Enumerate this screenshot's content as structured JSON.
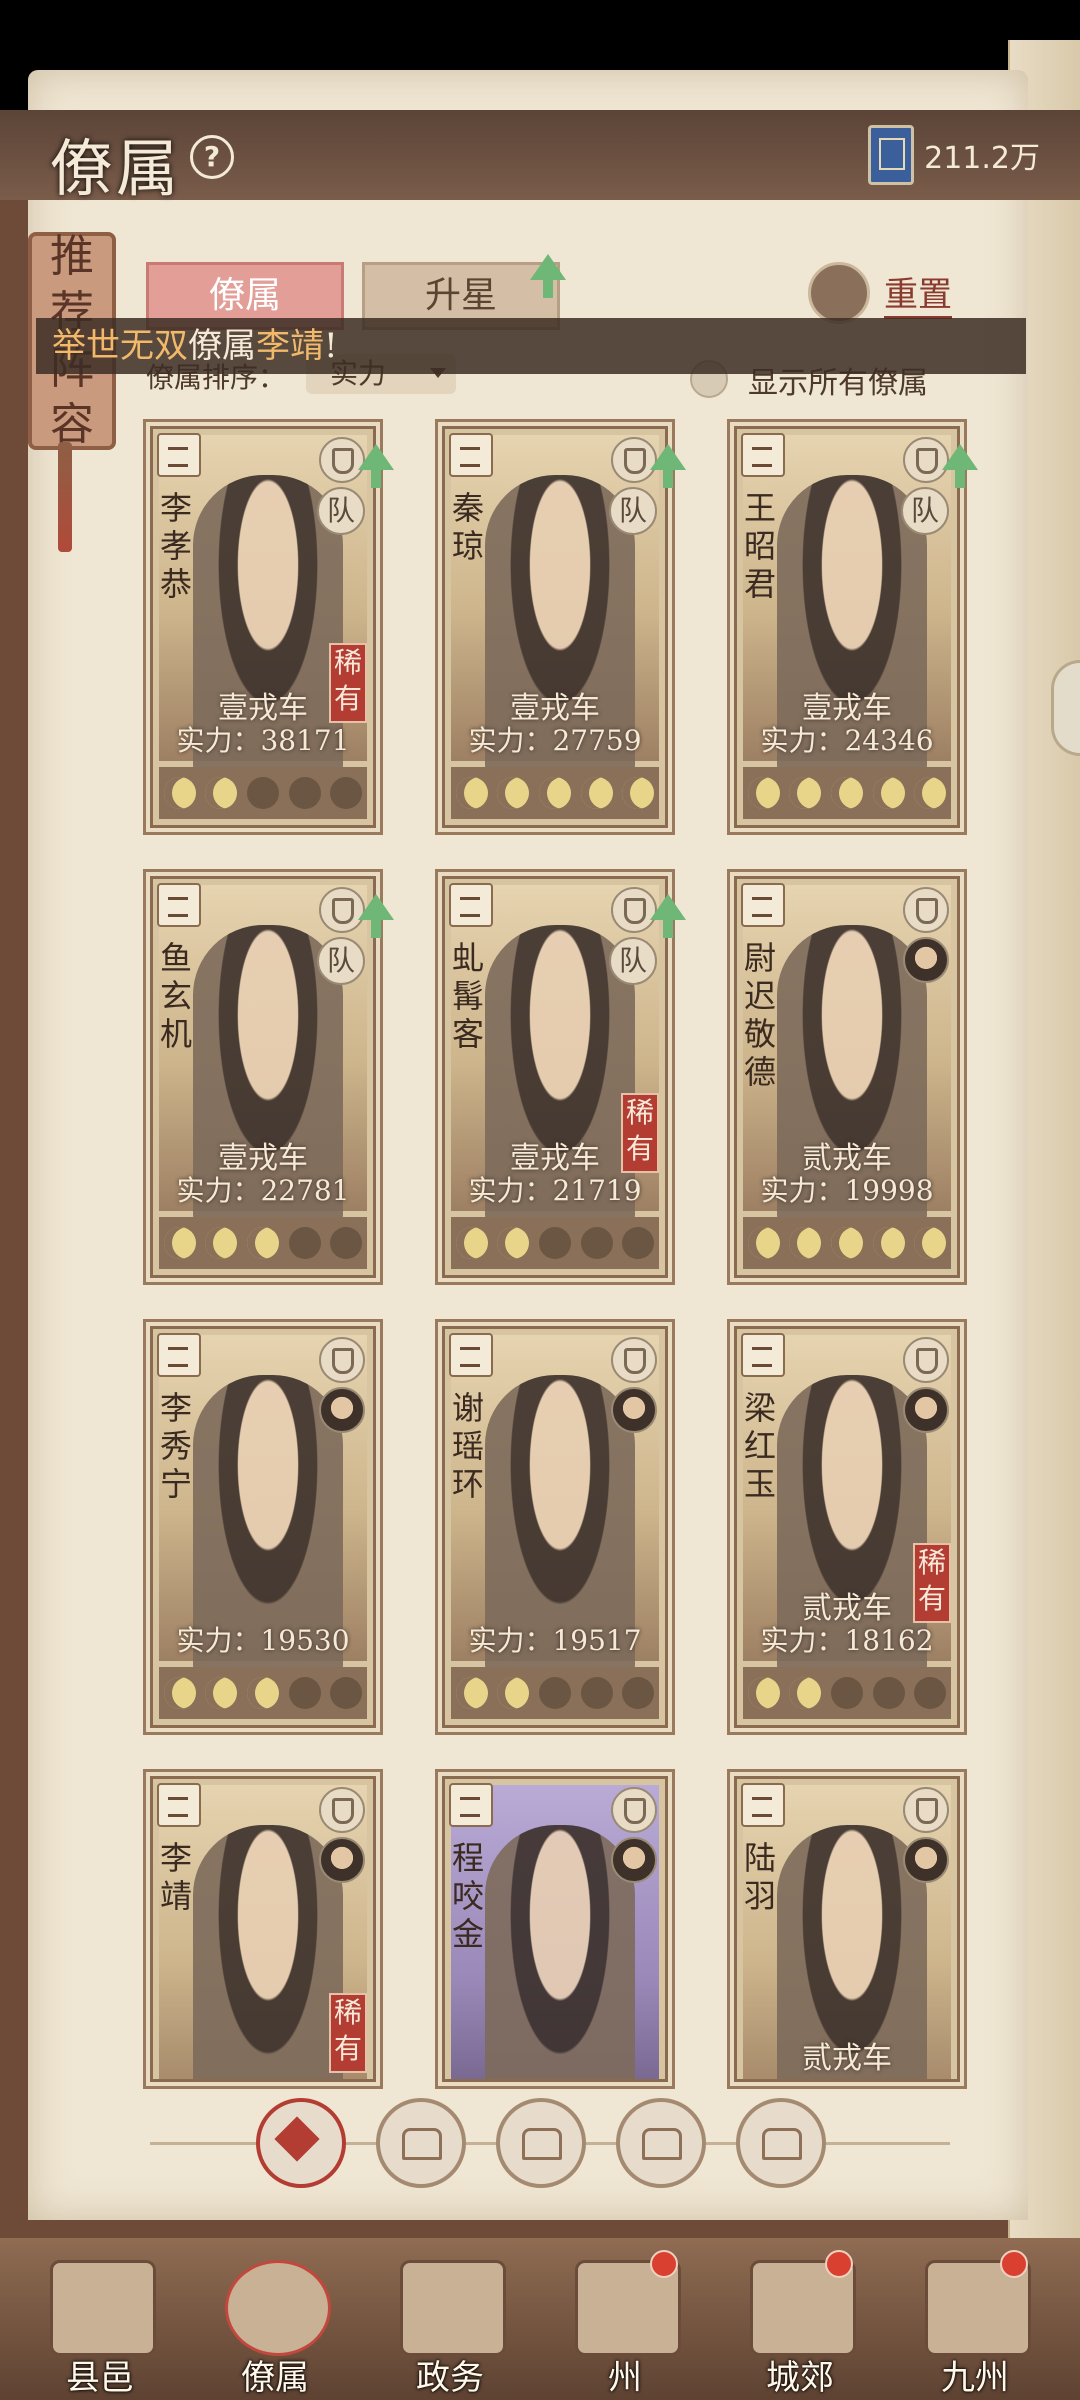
{
  "header": {
    "title": "僚属",
    "currency_value": "211.2万"
  },
  "side_tag": {
    "chars": [
      "推",
      "荐",
      "阵",
      "容"
    ]
  },
  "tabs": [
    {
      "label": "僚属"
    },
    {
      "label": "升星"
    }
  ],
  "reset": {
    "label": "重置"
  },
  "banner": {
    "prefix": "举世无双",
    "middle": "僚属",
    "name": "李靖",
    "suffix": "!"
  },
  "sort": {
    "label": "僚属排序：",
    "selected": "实力"
  },
  "show_all": {
    "label": "显示所有僚属"
  },
  "cards": [
    {
      "name": "李孝恭",
      "tier": "壹戎车",
      "power": "实力：38171",
      "rare": "稀有",
      "team": "队",
      "stars_on": 2,
      "upgrade": true
    },
    {
      "name": "秦琼",
      "tier": "壹戎车",
      "power": "实力：27759",
      "team": "队",
      "stars_on": 5,
      "upgrade": true
    },
    {
      "name": "王昭君",
      "tier": "壹戎车",
      "power": "实力：24346",
      "team": "队",
      "stars_on": 5,
      "upgrade": true
    },
    {
      "name": "鱼玄机",
      "tier": "壹戎车",
      "power": "实力：22781",
      "team": "队",
      "stars_on": 3,
      "upgrade": true
    },
    {
      "name": "虬髯客",
      "tier": "壹戎车",
      "power": "实力：21719",
      "rare": "稀有",
      "team": "队",
      "stars_on": 2,
      "upgrade": true
    },
    {
      "name": "尉迟敬德",
      "tier": "贰戎车",
      "power": "实力：19998",
      "stars_on": 5
    },
    {
      "name": "李秀宁",
      "tier": "",
      "power": "实力：19530",
      "stars_on": 3
    },
    {
      "name": "谢瑶环",
      "tier": "",
      "power": "实力：19517",
      "stars_on": 2
    },
    {
      "name": "梁红玉",
      "tier": "贰戎车",
      "power": "实力：18162",
      "rare": "稀有",
      "stars_on": 2
    },
    {
      "name": "李靖",
      "tier": "",
      "power": "",
      "rare": "稀有"
    },
    {
      "name": "程咬金",
      "tier": "",
      "power": ""
    },
    {
      "name": "陆羽",
      "tier": "贰戎车",
      "power": ""
    }
  ],
  "nav": [
    {
      "label": "县邑",
      "badge": false
    },
    {
      "label": "僚属",
      "badge": false
    },
    {
      "label": "政务",
      "badge": false
    },
    {
      "label": "州",
      "badge": true
    },
    {
      "label": "城郊",
      "badge": true
    },
    {
      "label": "九州",
      "badge": true
    }
  ]
}
